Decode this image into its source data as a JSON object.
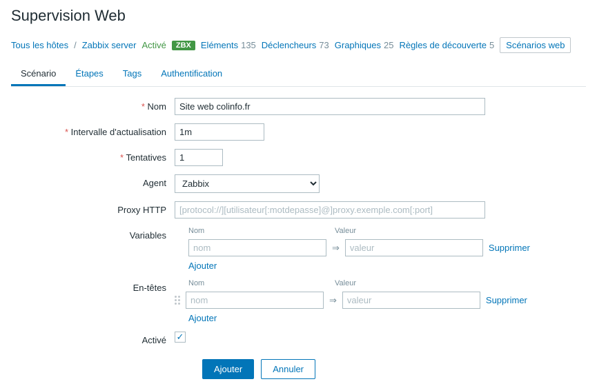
{
  "page_title": "Supervision Web",
  "breadcrumb": {
    "all_hosts": "Tous les hôtes",
    "host": "Zabbix server",
    "status": "Activé",
    "zbx": "ZBX",
    "items": [
      {
        "label": "Eléments",
        "count": "135"
      },
      {
        "label": "Déclencheurs",
        "count": "73"
      },
      {
        "label": "Graphiques",
        "count": "25"
      },
      {
        "label": "Règles de découverte",
        "count": "5"
      }
    ],
    "web_scenarios": "Scénarios web"
  },
  "tabs": [
    {
      "label": "Scénario",
      "active": true
    },
    {
      "label": "Étapes",
      "active": false
    },
    {
      "label": "Tags",
      "active": false
    },
    {
      "label": "Authentification",
      "active": false
    }
  ],
  "form": {
    "name_label": "Nom",
    "name_value": "Site web colinfo.fr",
    "interval_label": "Intervalle d'actualisation",
    "interval_value": "1m",
    "attempts_label": "Tentatives",
    "attempts_value": "1",
    "agent_label": "Agent",
    "agent_value": "Zabbix",
    "proxy_label": "Proxy HTTP",
    "proxy_placeholder": "[protocol://][utilisateur[:motdepasse]@]proxy.exemple.com[:port]",
    "variables_label": "Variables",
    "headers_label": "En-têtes",
    "kv_name_header": "Nom",
    "kv_value_header": "Valeur",
    "kv_name_placeholder": "nom",
    "kv_value_placeholder": "valeur",
    "delete_label": "Supprimer",
    "add_label": "Ajouter",
    "enabled_label": "Activé",
    "enabled_checked": true
  },
  "buttons": {
    "submit": "Ajouter",
    "cancel": "Annuler"
  }
}
